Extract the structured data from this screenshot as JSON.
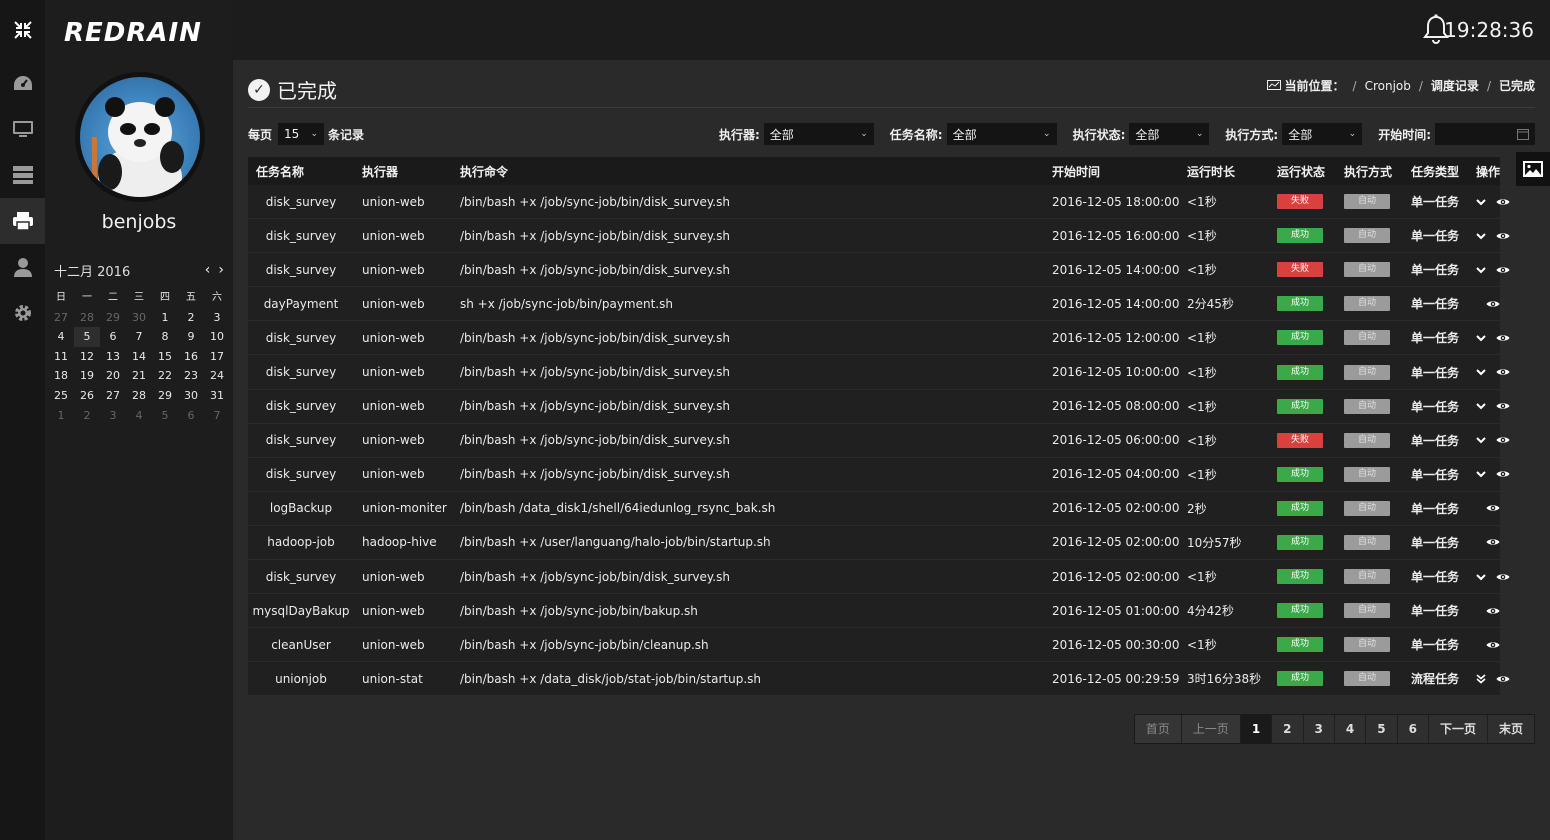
{
  "app": {
    "brand": "REDRAIN",
    "clock": "19:28:36"
  },
  "user": {
    "name": "benjobs"
  },
  "calendar": {
    "month_label": "十二月 2016",
    "weekdays": [
      "日",
      "一",
      "二",
      "三",
      "四",
      "五",
      "六"
    ],
    "weeks": [
      [
        "27",
        "28",
        "29",
        "30",
        "1",
        "2",
        "3"
      ],
      [
        "4",
        "5",
        "6",
        "7",
        "8",
        "9",
        "10"
      ],
      [
        "11",
        "12",
        "13",
        "14",
        "15",
        "16",
        "17"
      ],
      [
        "18",
        "19",
        "20",
        "21",
        "22",
        "23",
        "24"
      ],
      [
        "25",
        "26",
        "27",
        "28",
        "29",
        "30",
        "31"
      ],
      [
        "1",
        "2",
        "3",
        "4",
        "5",
        "6",
        "7"
      ]
    ]
  },
  "page": {
    "title": "已完成",
    "breadcrumb": {
      "prefix": "当前位置：",
      "items": [
        "Cronjob",
        "调度记录",
        "已完成"
      ]
    }
  },
  "filters": {
    "per_page_label": "每页",
    "per_page_value": "15",
    "records_label": "条记录",
    "executor_label": "执行器:",
    "executor_value": "全部",
    "job_name_label": "任务名称:",
    "job_name_value": "全部",
    "status_label": "执行状态:",
    "status_value": "全部",
    "mode_label": "执行方式:",
    "mode_value": "全部",
    "start_label": "开始时间:",
    "start_value": ""
  },
  "table": {
    "headers": [
      "任务名称",
      "执行器",
      "执行命令",
      "开始时间",
      "运行时长",
      "运行状态",
      "执行方式",
      "任务类型",
      "操作"
    ],
    "rows": [
      {
        "name": "disk_survey",
        "executor": "union-web",
        "command": "/bin/bash +x /job/sync-job/bin/disk_survey.sh",
        "start": "2016-12-05 18:00:00",
        "duration": "<1秒",
        "status": "失败",
        "mode": "自动",
        "type": "单一任务"
      },
      {
        "name": "disk_survey",
        "executor": "union-web",
        "command": "/bin/bash +x /job/sync-job/bin/disk_survey.sh",
        "start": "2016-12-05 16:00:00",
        "duration": "<1秒",
        "status": "成功",
        "mode": "自动",
        "type": "单一任务"
      },
      {
        "name": "disk_survey",
        "executor": "union-web",
        "command": "/bin/bash +x /job/sync-job/bin/disk_survey.sh",
        "start": "2016-12-05 14:00:00",
        "duration": "<1秒",
        "status": "失败",
        "mode": "自动",
        "type": "单一任务"
      },
      {
        "name": "dayPayment",
        "executor": "union-web",
        "command": "sh +x /job/sync-job/bin/payment.sh",
        "start": "2016-12-05 14:00:00",
        "duration": "2分45秒",
        "status": "成功",
        "mode": "自动",
        "type": "单一任务"
      },
      {
        "name": "disk_survey",
        "executor": "union-web",
        "command": "/bin/bash +x /job/sync-job/bin/disk_survey.sh",
        "start": "2016-12-05 12:00:00",
        "duration": "<1秒",
        "status": "成功",
        "mode": "自动",
        "type": "单一任务"
      },
      {
        "name": "disk_survey",
        "executor": "union-web",
        "command": "/bin/bash +x /job/sync-job/bin/disk_survey.sh",
        "start": "2016-12-05 10:00:00",
        "duration": "<1秒",
        "status": "成功",
        "mode": "自动",
        "type": "单一任务"
      },
      {
        "name": "disk_survey",
        "executor": "union-web",
        "command": "/bin/bash +x /job/sync-job/bin/disk_survey.sh",
        "start": "2016-12-05 08:00:00",
        "duration": "<1秒",
        "status": "成功",
        "mode": "自动",
        "type": "单一任务"
      },
      {
        "name": "disk_survey",
        "executor": "union-web",
        "command": "/bin/bash +x /job/sync-job/bin/disk_survey.sh",
        "start": "2016-12-05 06:00:00",
        "duration": "<1秒",
        "status": "失败",
        "mode": "自动",
        "type": "单一任务"
      },
      {
        "name": "disk_survey",
        "executor": "union-web",
        "command": "/bin/bash +x /job/sync-job/bin/disk_survey.sh",
        "start": "2016-12-05 04:00:00",
        "duration": "<1秒",
        "status": "成功",
        "mode": "自动",
        "type": "单一任务"
      },
      {
        "name": "logBackup",
        "executor": "union-moniter",
        "command": "/bin/bash /data_disk1/shell/64iedunlog_rsync_bak.sh",
        "start": "2016-12-05 02:00:00",
        "duration": "2秒",
        "status": "成功",
        "mode": "自动",
        "type": "单一任务"
      },
      {
        "name": "hadoop-job",
        "executor": "hadoop-hive",
        "command": "/bin/bash +x /user/languang/halo-job/bin/startup.sh",
        "start": "2016-12-05 02:00:00",
        "duration": "10分57秒",
        "status": "成功",
        "mode": "自动",
        "type": "单一任务"
      },
      {
        "name": "disk_survey",
        "executor": "union-web",
        "command": "/bin/bash +x /job/sync-job/bin/disk_survey.sh",
        "start": "2016-12-05 02:00:00",
        "duration": "<1秒",
        "status": "成功",
        "mode": "自动",
        "type": "单一任务"
      },
      {
        "name": "mysqlDayBakup",
        "executor": "union-web",
        "command": "/bin/bash +x /job/sync-job/bin/bakup.sh",
        "start": "2016-12-05 01:00:00",
        "duration": "4分42秒",
        "status": "成功",
        "mode": "自动",
        "type": "单一任务"
      },
      {
        "name": "cleanUser",
        "executor": "union-web",
        "command": "/bin/bash +x /job/sync-job/bin/cleanup.sh",
        "start": "2016-12-05 00:30:00",
        "duration": "<1秒",
        "status": "成功",
        "mode": "自动",
        "type": "单一任务"
      },
      {
        "name": "unionjob",
        "executor": "union-stat",
        "command": "/bin/bash +x /data_disk/job/stat-job/bin/startup.sh",
        "start": "2016-12-05 00:29:59",
        "duration": "3时16分38秒",
        "status": "成功",
        "mode": "自动",
        "type": "流程任务"
      }
    ],
    "row_ops": [
      "chevron",
      "chevron",
      "chevron",
      "none",
      "chevron",
      "chevron",
      "chevron",
      "chevron",
      "chevron",
      "none",
      "none",
      "chevron",
      "none",
      "none",
      "double-chevron"
    ]
  },
  "pagination": {
    "first": "首页",
    "prev": "上一页",
    "pages": [
      "1",
      "2",
      "3",
      "4",
      "5",
      "6"
    ],
    "current": "1",
    "next": "下一页",
    "last": "末页"
  },
  "colors": {
    "success": "#3aa94a",
    "fail": "#d9413e",
    "auto": "#9b9b9b"
  }
}
